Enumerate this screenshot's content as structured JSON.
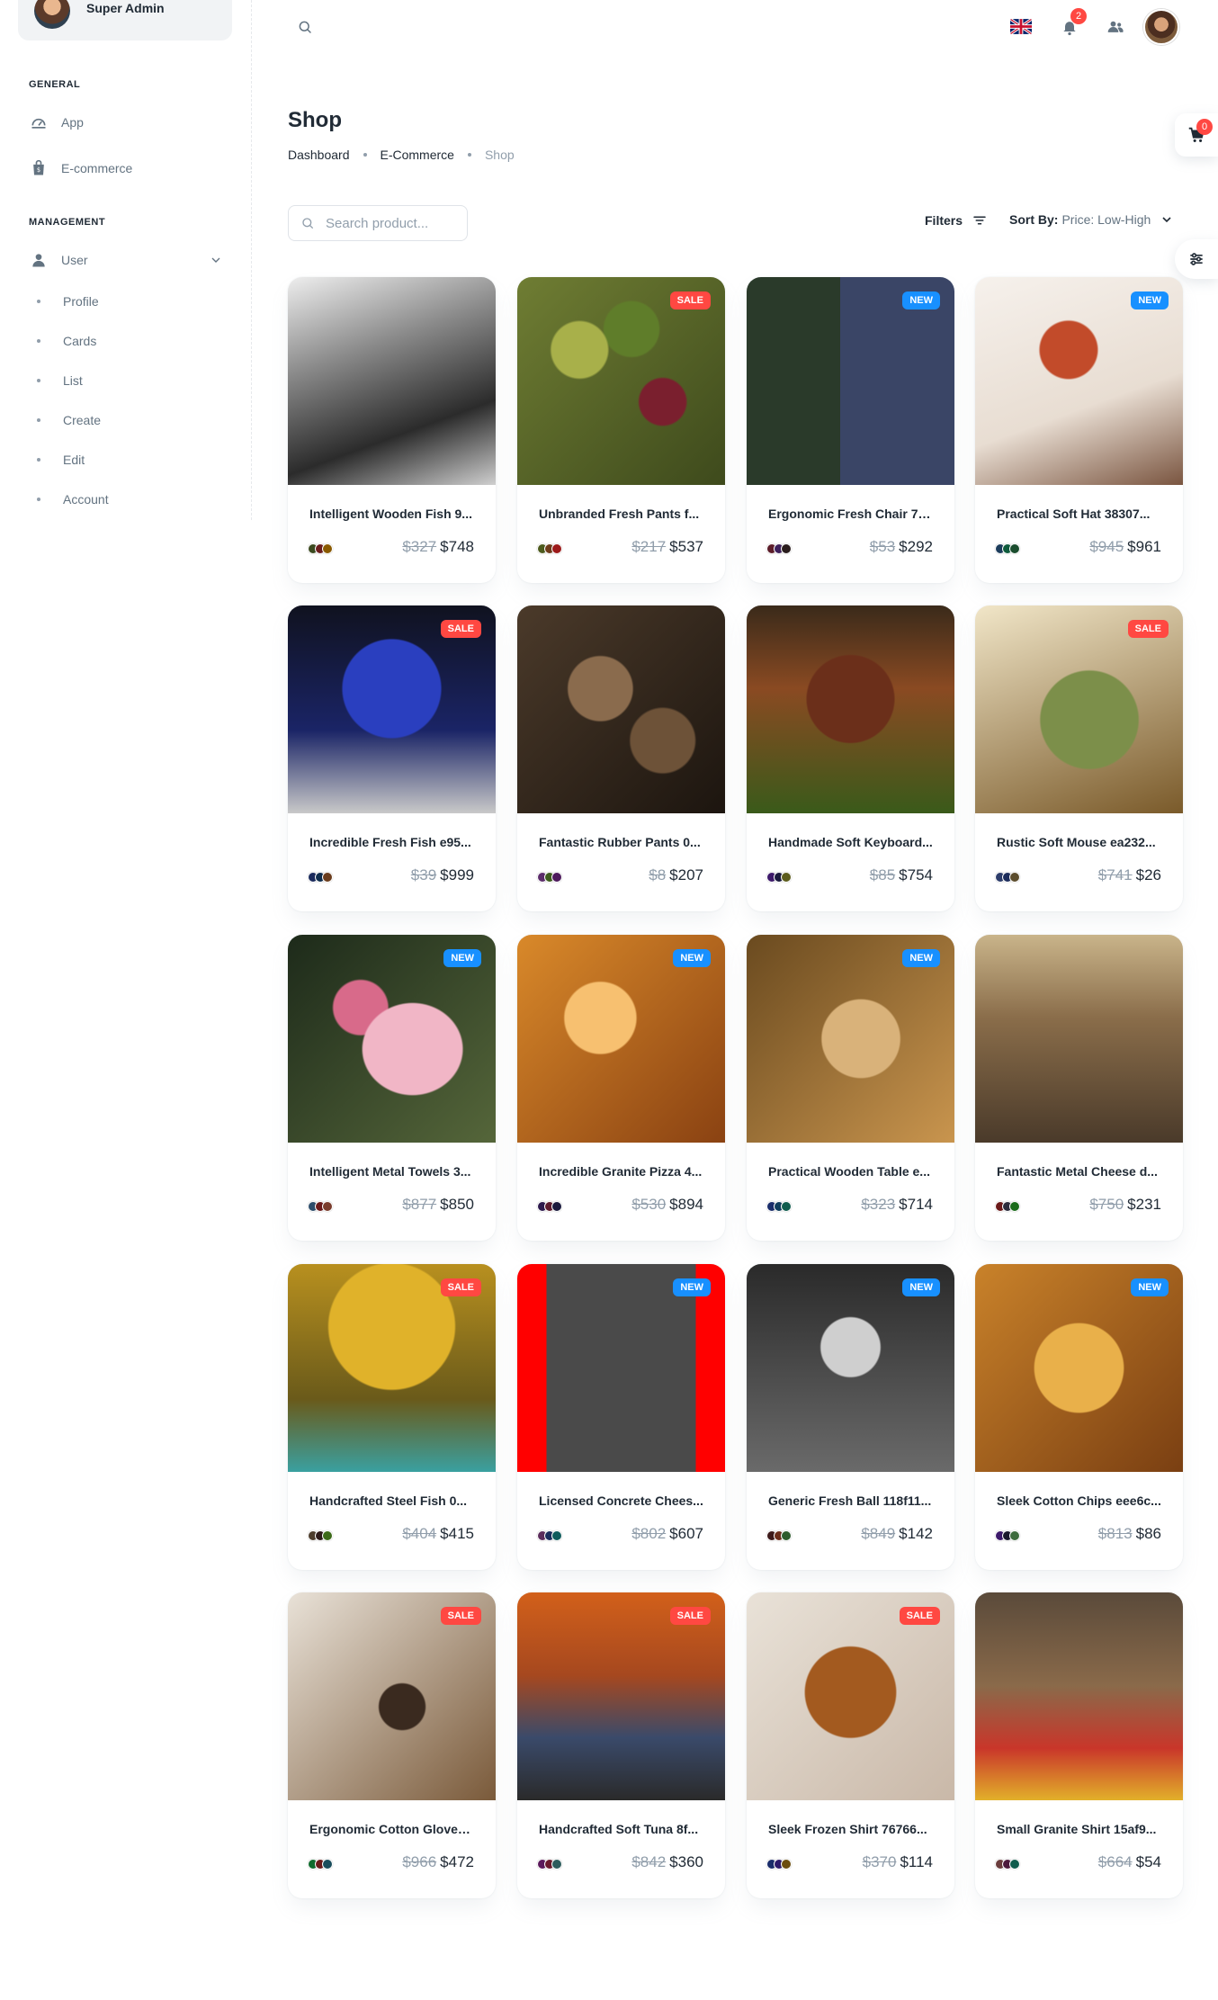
{
  "account": {
    "name": "Super Admin"
  },
  "sidebar": {
    "general_label": "GENERAL",
    "general": [
      {
        "label": "App",
        "icon": "dashboard-icon"
      },
      {
        "label": "E-commerce",
        "icon": "shopping-bag-icon"
      }
    ],
    "management_label": "MANAGEMENT",
    "user": {
      "label": "User",
      "icon": "user-icon"
    },
    "user_items": [
      "Profile",
      "Cards",
      "List",
      "Create",
      "Edit",
      "Account"
    ]
  },
  "header": {
    "notifications_count": "2",
    "language": "English",
    "cart_count": "0"
  },
  "page": {
    "title": "Shop",
    "breadcrumb": [
      "Dashboard",
      "E-Commerce",
      "Shop"
    ],
    "search_placeholder": "Search product...",
    "filters_label": "Filters",
    "sort_label": "Sort By:",
    "sort_value": "Price: Low-High"
  },
  "colors": {
    "sale": "#ff4842",
    "new": "#1890ff",
    "text": "#212b36",
    "muted": "#919eab"
  },
  "products": [
    {
      "name": "Intelligent Wooden Fish 9...",
      "label": "",
      "old_price": "$327",
      "price": "$748",
      "colors": [
        "#3b4a1f",
        "#6b1d1d",
        "#8a5a00"
      ]
    },
    {
      "name": "Unbranded Fresh Pants f...",
      "label": "SALE",
      "old_price": "$217",
      "price": "$537",
      "colors": [
        "#4d5b1d",
        "#6e3b1a",
        "#9c1a1a"
      ]
    },
    {
      "name": "Ergonomic Fresh Chair 76...",
      "label": "NEW",
      "old_price": "$53",
      "price": "$292",
      "colors": [
        "#5c1d2a",
        "#3d1f5a",
        "#2a1d1d"
      ]
    },
    {
      "name": "Practical Soft Hat 38307...",
      "label": "NEW",
      "old_price": "$945",
      "price": "$961",
      "colors": [
        "#1d3d5c",
        "#0f5c3d",
        "#1a4d2e"
      ]
    },
    {
      "name": "Incredible Fresh Fish e95...",
      "label": "SALE",
      "old_price": "$39",
      "price": "$999",
      "colors": [
        "#1a2a5c",
        "#0f2d4d",
        "#6b3d1d"
      ]
    },
    {
      "name": "Fantastic Rubber Pants 0...",
      "label": "",
      "old_price": "$8",
      "price": "$207",
      "colors": [
        "#5c2d6b",
        "#3d5c1d",
        "#4d1a5c"
      ]
    },
    {
      "name": "Handmade Soft Keyboard...",
      "label": "",
      "old_price": "$85",
      "price": "$754",
      "colors": [
        "#3d1a6b",
        "#1a1a3d",
        "#5c5c1d"
      ]
    },
    {
      "name": "Rustic Soft Mouse ea232...",
      "label": "SALE",
      "old_price": "$741",
      "price": "$26",
      "colors": [
        "#2d3d6b",
        "#1d2d5c",
        "#5c4d2d"
      ]
    },
    {
      "name": "Intelligent Metal Towels 3...",
      "label": "NEW",
      "old_price": "$877",
      "price": "$850",
      "colors": [
        "#2d4d6b",
        "#6b1a1a",
        "#7a3d2d"
      ]
    },
    {
      "name": "Incredible Granite Pizza 4...",
      "label": "NEW",
      "old_price": "$530",
      "price": "$894",
      "colors": [
        "#2d1a4d",
        "#5c1a2d",
        "#1a1a3d"
      ]
    },
    {
      "name": "Practical Wooden Table e...",
      "label": "NEW",
      "old_price": "$323",
      "price": "$714",
      "colors": [
        "#1a2d6b",
        "#0f3d5c",
        "#0f5c4d"
      ]
    },
    {
      "name": "Fantastic Metal Cheese d...",
      "label": "",
      "old_price": "$750",
      "price": "$231",
      "colors": [
        "#6b1a1a",
        "#2d2d3d",
        "#1a6b1a"
      ]
    },
    {
      "name": "Handcrafted Steel Fish 0...",
      "label": "SALE",
      "old_price": "$404",
      "price": "$415",
      "colors": [
        "#4d3d2d",
        "#2d1a1a",
        "#3d6b1a"
      ]
    },
    {
      "name": "Licensed Concrete Chees...",
      "label": "NEW",
      "old_price": "$802",
      "price": "$607",
      "colors": [
        "#5c2d5c",
        "#1a2d5c",
        "#0f5c5c"
      ]
    },
    {
      "name": "Generic Fresh Ball 118f11...",
      "label": "NEW",
      "old_price": "$849",
      "price": "$142",
      "colors": [
        "#3d1a1a",
        "#6b2d1a",
        "#2d5c2d"
      ]
    },
    {
      "name": "Sleek Cotton Chips eee6c...",
      "label": "NEW",
      "old_price": "$813",
      "price": "$86",
      "colors": [
        "#3d1a6b",
        "#1a1a2d",
        "#3d6b3d"
      ]
    },
    {
      "name": "Ergonomic Cotton Gloves ...",
      "label": "SALE",
      "old_price": "$966",
      "price": "$472",
      "colors": [
        "#0f6b2d",
        "#6b1a1a",
        "#1a4d5c"
      ]
    },
    {
      "name": "Handcrafted Soft Tuna 8f...",
      "label": "SALE",
      "old_price": "$842",
      "price": "$360",
      "colors": [
        "#5c1a5c",
        "#6b1a2d",
        "#2d5c5c"
      ]
    },
    {
      "name": "Sleek Frozen Shirt 76766...",
      "label": "SALE",
      "old_price": "$370",
      "price": "$114",
      "colors": [
        "#1a2d6b",
        "#2d1a6b",
        "#6b4d0f"
      ]
    },
    {
      "name": "Small Granite Shirt 15af9...",
      "label": "",
      "old_price": "$664",
      "price": "$54",
      "colors": [
        "#6b3d3d",
        "#4d1a3d",
        "#0f5c4d"
      ]
    }
  ]
}
